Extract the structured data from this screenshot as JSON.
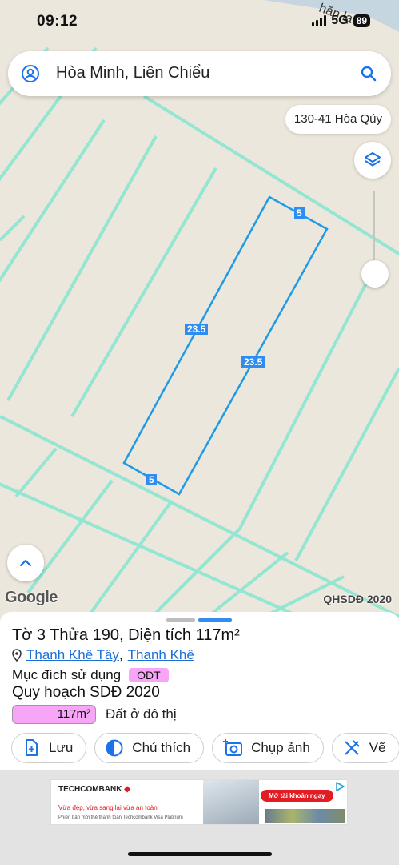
{
  "status_bar": {
    "time": "09:12",
    "network": "5G",
    "battery": "89"
  },
  "search": {
    "query": "Hòa Minh, Liên Chiểu"
  },
  "address_pill": "130-41 Hòa Qúy",
  "map": {
    "edge_labels": [
      "5",
      "23.5",
      "23.5",
      "5"
    ],
    "google_logo": "Google",
    "source_label": "QHSDĐ 2020",
    "road_label": "hăn lạ"
  },
  "parcel": {
    "title": "Tờ 3 Thửa 190, Diện tích 117m²",
    "ward": "Thanh Khê Tây",
    "separator": ",",
    "district": "Thanh Khê",
    "purpose_label": "Mục đích sử dụng",
    "purpose_code": "ODT",
    "plan_title": "Quy hoạch SDĐ 2020",
    "plan_area": "117m²",
    "plan_desc": "Đất ở đô thị"
  },
  "actions": [
    {
      "label": "Lưu",
      "icon": "add-file-icon"
    },
    {
      "label": "Chú thích",
      "icon": "contrast-icon"
    },
    {
      "label": "Chụp ảnh",
      "icon": "camera-icon"
    },
    {
      "label": "Vẽ",
      "icon": "ruler-icon"
    }
  ],
  "ad": {
    "brand": "TECHCOMBANK",
    "tagline": "Vừa đẹp, vừa sang lại vừa an toàn",
    "fine_print": "Phiên bản mới thẻ thanh toán Techcombank Visa Platinum",
    "cta": "Mở tài khoản ngay"
  },
  "colors": {
    "accent": "#2f8cf0",
    "parcel_line": "#1e9be6",
    "zone_lines": "#7fe3cf",
    "land_use": "#f7a6f7"
  }
}
